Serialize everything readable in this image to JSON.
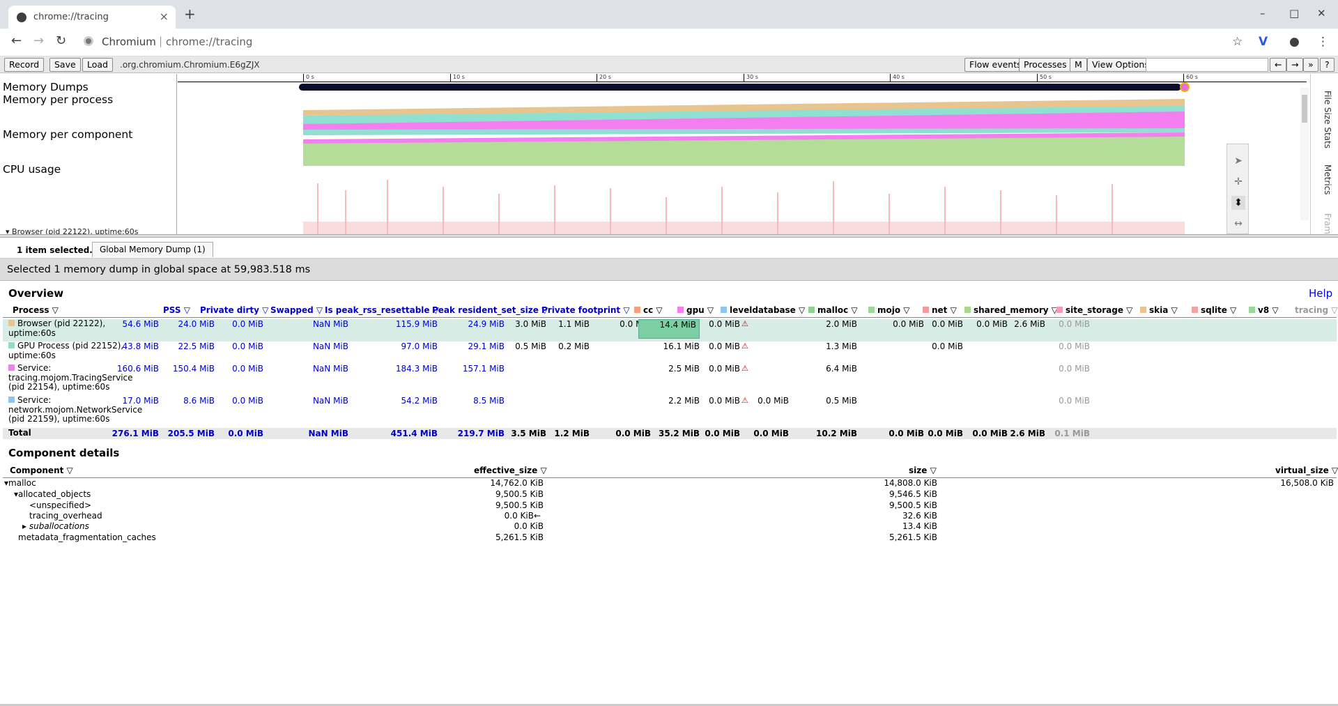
{
  "browser": {
    "tab_title": "chrome://tracing",
    "omnibox_site": "Chromium",
    "omnibox_url": "chrome://tracing"
  },
  "controls": {
    "record": "Record",
    "save": "Save",
    "load": "Load",
    "trace_file": ".org.chromium.Chromium.E6gZJX",
    "flow_events": "Flow events",
    "processes": "Processes",
    "m": "M",
    "view_options": "View Options",
    "prev": "←",
    "next": "→",
    "more": "»",
    "help": "?"
  },
  "timeline": {
    "tracks": [
      "Memory Dumps",
      "Memory per process",
      "Memory per component",
      "CPU usage"
    ],
    "ruler_ticks": [
      "0 s",
      "10 s",
      "20 s",
      "30 s",
      "40 s",
      "50 s",
      "60 s"
    ],
    "process_row": "Browser (pid 22122), uptime:60s",
    "side_tabs": [
      "File Size Stats",
      "Metrics",
      "Frame"
    ]
  },
  "selection": {
    "count": "1 item selected.",
    "tab": "Global Memory Dump (1)",
    "message": "Selected 1 memory dump in global space at 59,983.518 ms"
  },
  "overview": {
    "title": "Overview",
    "help": "Help",
    "headers": {
      "process": "Process",
      "pss": "PSS",
      "private_dirty": "Private dirty",
      "swapped": "Swapped",
      "is_peak": "Is peak_rss_resettable",
      "peak_rss": "Peak resident_set_size",
      "private_footprint": "Private footprint",
      "cc": "cc",
      "gpu": "gpu",
      "leveldatabase": "leveldatabase",
      "malloc": "malloc",
      "mojo": "mojo",
      "net": "net",
      "shared_memory": "shared_memory",
      "site_storage": "site_storage",
      "skia": "skia",
      "sqlite": "sqlite",
      "v8": "v8",
      "tracing": "tracing"
    },
    "header_colors": {
      "cc": "#f4a27e",
      "gpu": "#f47ef0",
      "leveldatabase": "#8ec5f0",
      "malloc": "#8fd18f",
      "mojo": "#9ad99a",
      "net": "#f49a9a",
      "shared_memory": "#a8d88a",
      "site_storage": "#f49ab4",
      "skia": "#e8c48e",
      "sqlite": "#f4a2a2",
      "v8": "#9ad89a"
    },
    "rows": [
      {
        "name": "Browser (pid 22122), uptime:60s",
        "color": "#e8c48e",
        "pss": "54.6 MiB",
        "private_dirty": "24.0 MiB",
        "swapped": "0.0 MiB",
        "is_peak": "NaN MiB",
        "peak_rss": "115.9 MiB",
        "private_footprint": "24.9 MiB",
        "cc": "3.0 MiB",
        "gpu": "1.1 MiB",
        "leveldatabase": "0.0 MiB",
        "malloc": "14.4 MiB",
        "mojo": "0.0 MiB",
        "net": "",
        "shared_memory": "2.0 MiB",
        "site_storage": "0.0 MiB",
        "skia": "0.0 MiB",
        "sqlite": "0.0 MiB",
        "v8": "2.6 MiB",
        "tracing": "0.0 MiB"
      },
      {
        "name": "GPU Process (pid 22152), uptime:60s",
        "color": "#8fe0b8",
        "pss": "43.8 MiB",
        "private_dirty": "22.5 MiB",
        "swapped": "0.0 MiB",
        "is_peak": "NaN MiB",
        "peak_rss": "97.0 MiB",
        "private_footprint": "29.1 MiB",
        "cc": "0.5 MiB",
        "gpu": "0.2 MiB",
        "leveldatabase": "",
        "malloc": "16.1 MiB",
        "mojo": "0.0 MiB",
        "net": "",
        "shared_memory": "1.3 MiB",
        "site_storage": "",
        "skia": "0.0 MiB",
        "sqlite": "",
        "v8": "",
        "tracing": "0.0 MiB"
      },
      {
        "name": "Service: tracing.mojom.TracingService (pid 22154), uptime:60s",
        "color": "#f47ef0",
        "pss": "160.6 MiB",
        "private_dirty": "150.4 MiB",
        "swapped": "0.0 MiB",
        "is_peak": "NaN MiB",
        "peak_rss": "184.3 MiB",
        "private_footprint": "157.1 MiB",
        "cc": "",
        "gpu": "",
        "leveldatabase": "",
        "malloc": "2.5 MiB",
        "mojo": "0.0 MiB",
        "net": "",
        "shared_memory": "6.4 MiB",
        "site_storage": "",
        "skia": "",
        "sqlite": "",
        "v8": "",
        "tracing": "0.0 MiB"
      },
      {
        "name": "Service: network.mojom.NetworkService (pid 22159), uptime:60s",
        "color": "#8ec5f0",
        "pss": "17.0 MiB",
        "private_dirty": "8.6 MiB",
        "swapped": "0.0 MiB",
        "is_peak": "NaN MiB",
        "peak_rss": "54.2 MiB",
        "private_footprint": "8.5 MiB",
        "cc": "",
        "gpu": "",
        "leveldatabase": "",
        "malloc": "2.2 MiB",
        "mojo": "0.0 MiB",
        "net": "0.0 MiB",
        "shared_memory": "0.5 MiB",
        "site_storage": "",
        "skia": "",
        "sqlite": "",
        "v8": "",
        "tracing": "0.0 MiB"
      }
    ],
    "total": {
      "name": "Total",
      "pss": "276.1 MiB",
      "private_dirty": "205.5 MiB",
      "swapped": "0.0 MiB",
      "is_peak": "NaN MiB",
      "peak_rss": "451.4 MiB",
      "private_footprint": "219.7 MiB",
      "cc": "3.5 MiB",
      "gpu": "1.2 MiB",
      "leveldatabase": "0.0 MiB",
      "malloc": "35.2 MiB",
      "mojo": "0.0 MiB",
      "net": "0.0 MiB",
      "shared_memory": "10.2 MiB",
      "site_storage": "0.0 MiB",
      "skia": "0.0 MiB",
      "sqlite": "0.0 MiB",
      "v8": "2.6 MiB",
      "tracing": "0.1 MiB"
    },
    "warning_glyph": "⚠"
  },
  "component_details": {
    "title": "Component details",
    "headers": {
      "component": "Component",
      "effective_size": "effective_size",
      "size": "size",
      "virtual_size": "virtual_size"
    },
    "rows": [
      {
        "name": "malloc",
        "effective_size": "14,762.0 KiB",
        "size": "14,808.0 KiB",
        "virtual_size": "16,508.0 KiB"
      },
      {
        "name": "allocated_objects",
        "effective_size": "9,500.5 KiB",
        "size": "9,546.5 KiB",
        "virtual_size": ""
      },
      {
        "name": "<unspecified>",
        "effective_size": "9,500.5 KiB",
        "size": "9,500.5 KiB",
        "virtual_size": ""
      },
      {
        "name": "tracing_overhead",
        "effective_size": "0.0 KiB",
        "size": "32.6 KiB",
        "virtual_size": ""
      },
      {
        "name": "suballocations",
        "effective_size": "0.0 KiB",
        "size": "13.4 KiB",
        "virtual_size": ""
      },
      {
        "name": "metadata_fragmentation_caches",
        "effective_size": "5,261.5 KiB",
        "size": "5,261.5 KiB",
        "virtual_size": ""
      }
    ],
    "arrow": "←"
  }
}
